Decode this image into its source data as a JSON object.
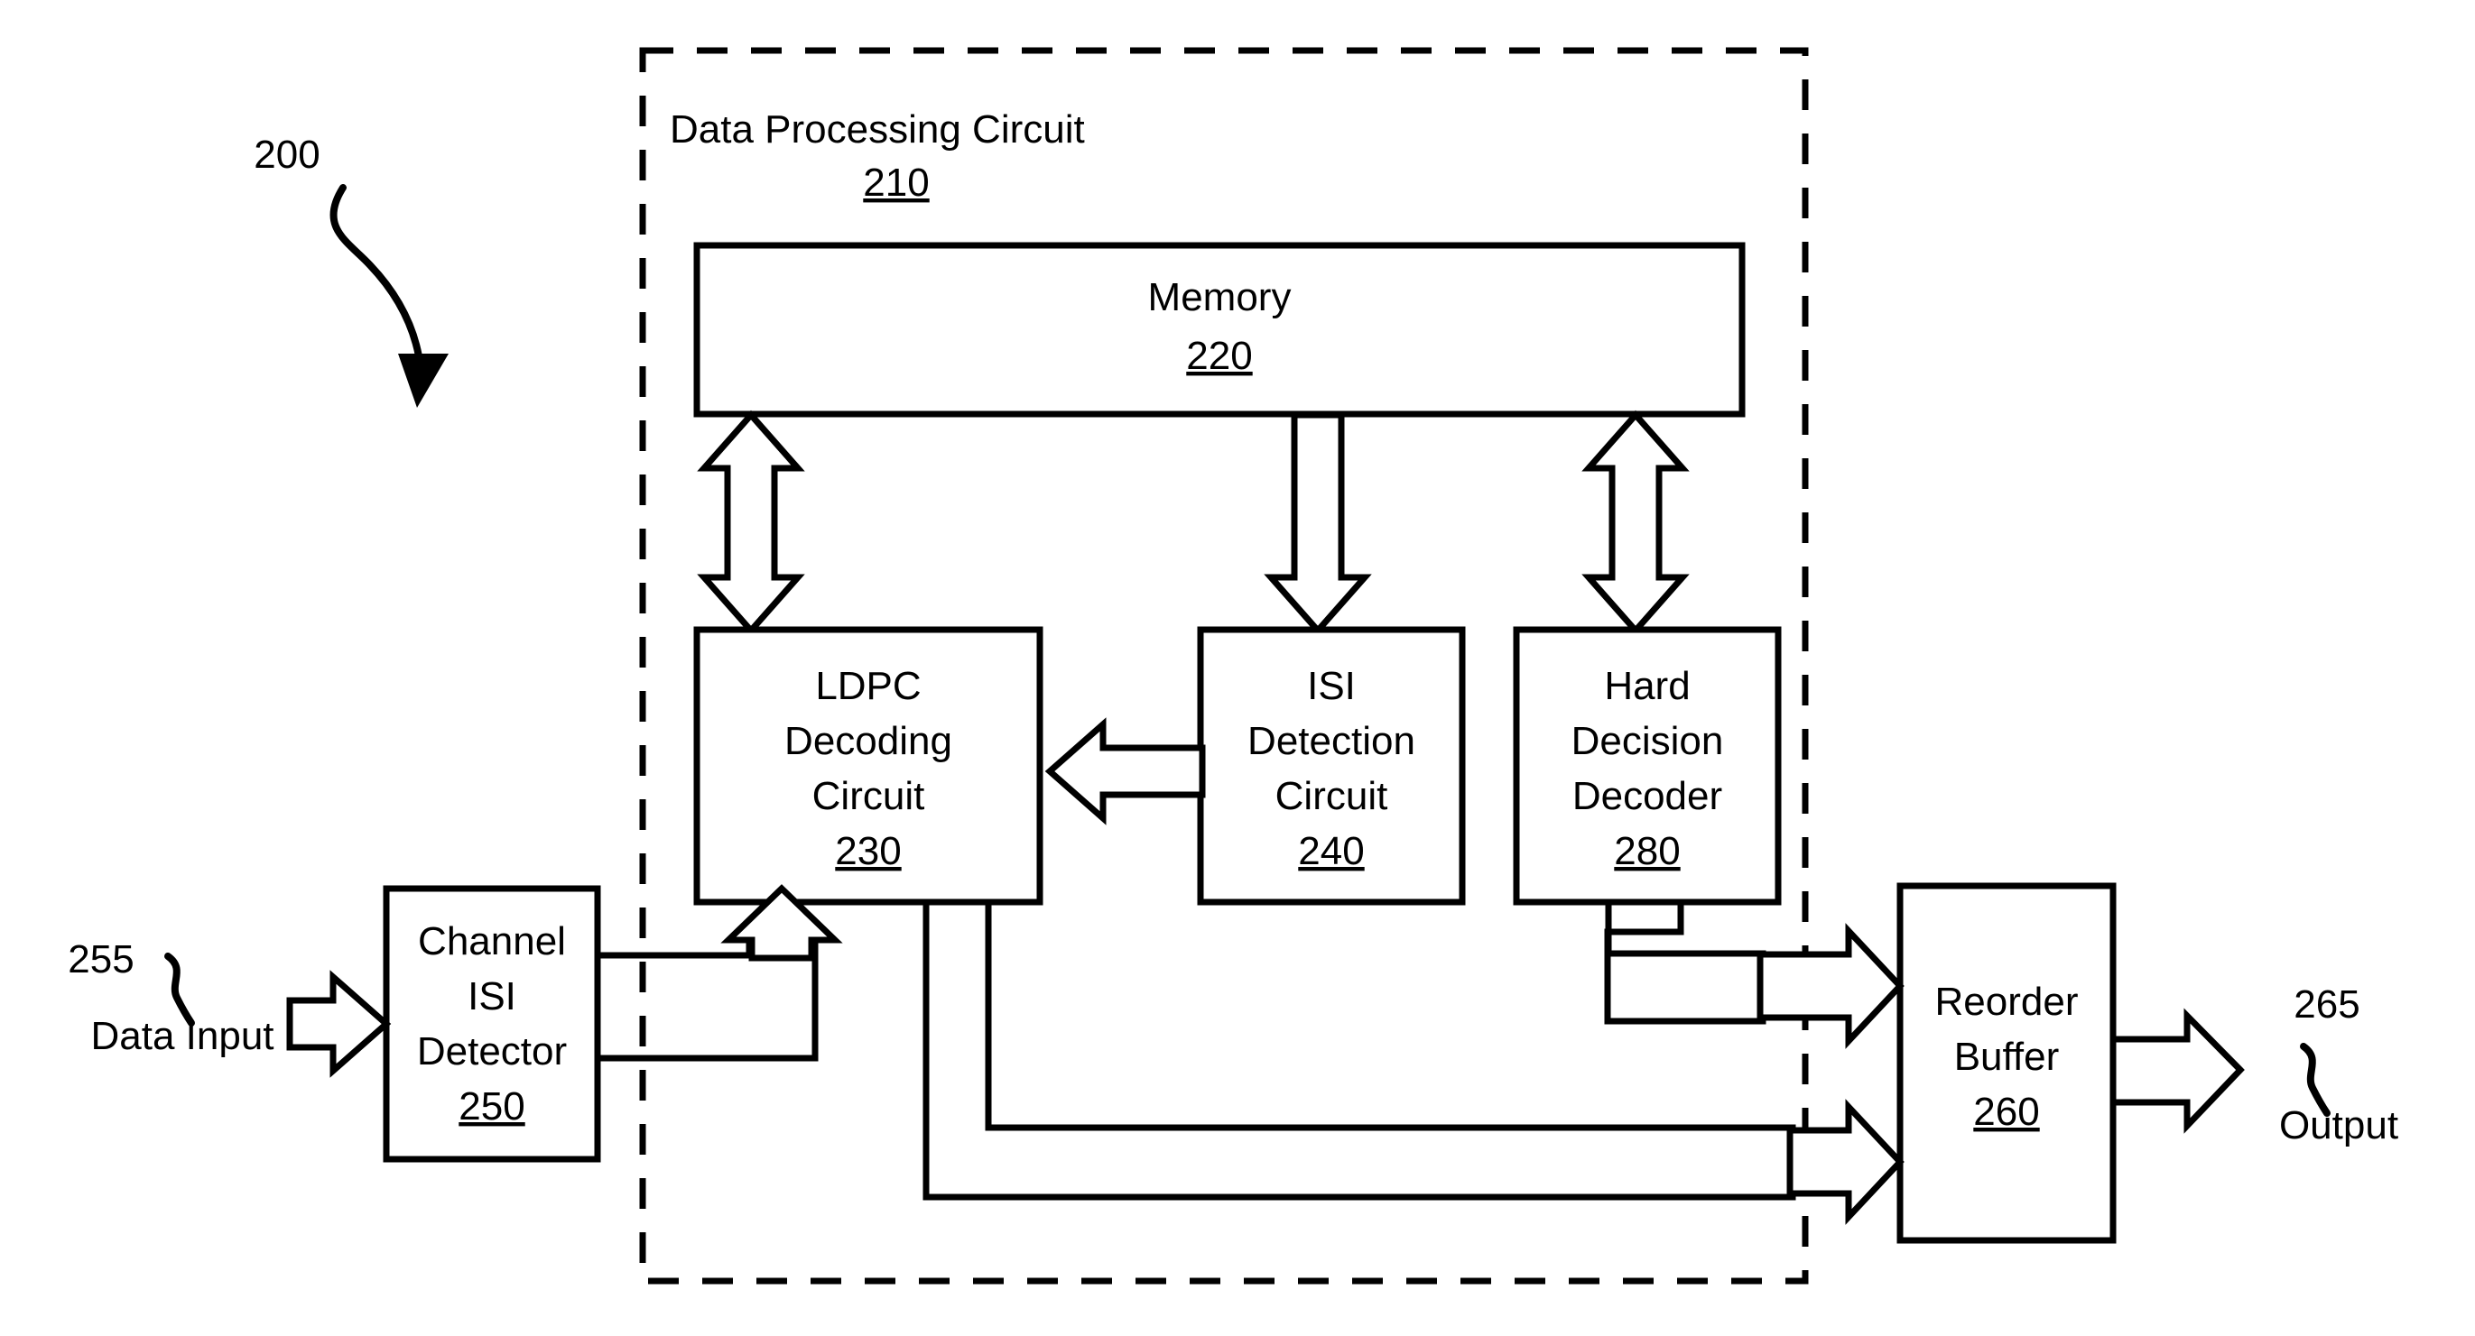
{
  "figure": {
    "figure_number": "200",
    "boundary": {
      "title": "Data Processing Circuit",
      "ref": "210",
      "style": "dashed"
    }
  },
  "blocks": {
    "memory": {
      "label": "Memory",
      "ref": "220"
    },
    "ldpc": {
      "line1": "LDPC",
      "line2": "Decoding",
      "line3": "Circuit",
      "ref": "230"
    },
    "isi_detection": {
      "line1": "ISI",
      "line2": "Detection",
      "line3": "Circuit",
      "ref": "240"
    },
    "hard_decision": {
      "line1": "Hard",
      "line2": "Decision",
      "line3": "Decoder",
      "ref": "280"
    },
    "channel_isi": {
      "line1": "Channel",
      "line2": "ISI",
      "line3": "Detector",
      "ref": "250"
    },
    "reorder_buffer": {
      "line1": "Reorder",
      "line2": "Buffer",
      "ref": "260"
    }
  },
  "io": {
    "input": {
      "ref": "255",
      "label": "Data Input"
    },
    "output": {
      "ref": "265",
      "label": "Output"
    }
  },
  "colors": {
    "stroke": "#000000",
    "fill": "#ffffff",
    "background": "#ffffff"
  }
}
